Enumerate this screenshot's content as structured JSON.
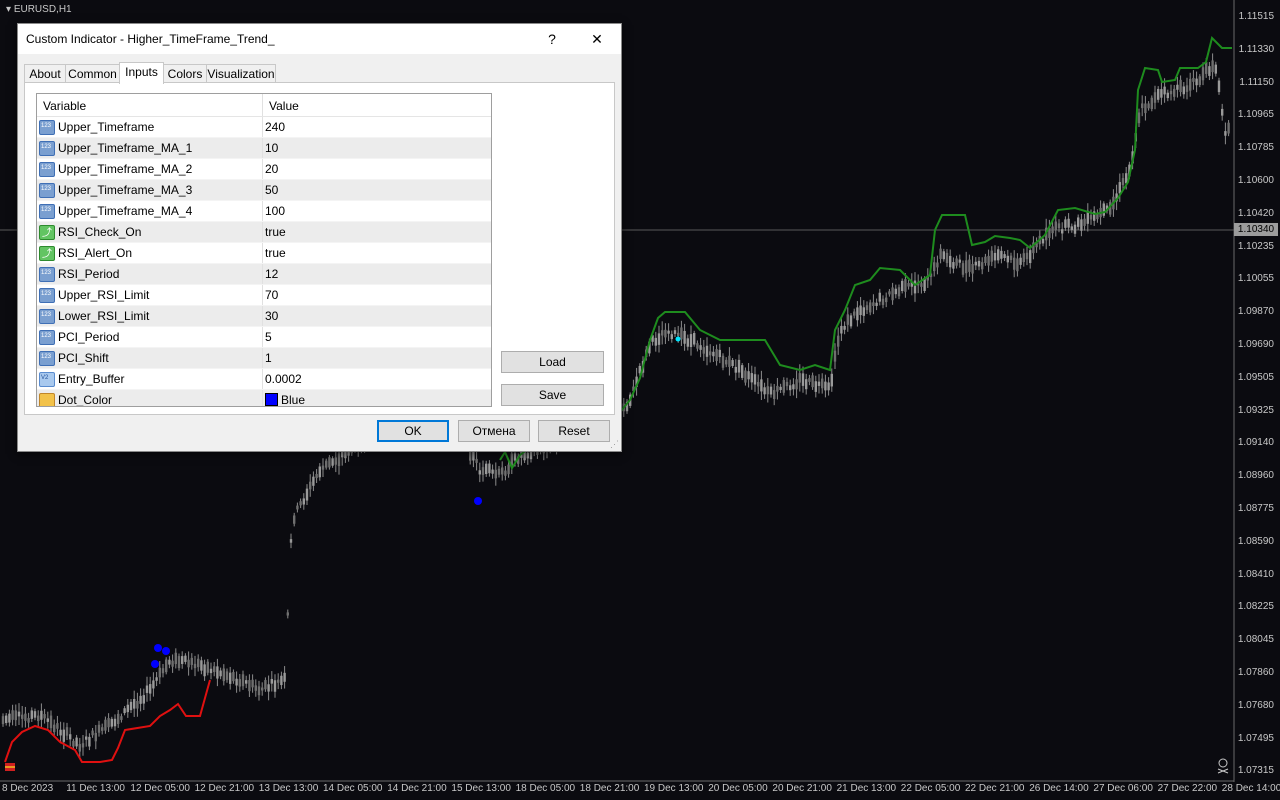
{
  "chart": {
    "symbol": "EURUSD,H1",
    "current_price": "1.10340",
    "price_labels": [
      "1.11515",
      "1.11330",
      "1.11150",
      "1.10965",
      "1.10785",
      "1.10600",
      "1.10420",
      "1.10235",
      "1.10055",
      "1.09870",
      "1.09690",
      "1.09505",
      "1.09325",
      "1.09140",
      "1.08960",
      "1.08775",
      "1.08590",
      "1.08410",
      "1.08225",
      "1.08045",
      "1.07860",
      "1.07680",
      "1.07495",
      "1.07315"
    ],
    "time_labels": [
      "8 Dec 2023",
      "11 Dec 13:00",
      "12 Dec 05:00",
      "12 Dec 21:00",
      "13 Dec 13:00",
      "14 Dec 05:00",
      "14 Dec 21:00",
      "15 Dec 13:00",
      "18 Dec 05:00",
      "18 Dec 21:00",
      "19 Dec 13:00",
      "20 Dec 05:00",
      "20 Dec 21:00",
      "21 Dec 13:00",
      "22 Dec 05:00",
      "22 Dec 21:00",
      "26 Dec 14:00",
      "27 Dec 06:00",
      "27 Dec 22:00",
      "28 Dec 14:00"
    ],
    "colors": {
      "background": "#0b0b10",
      "candles": "#8c8c8c",
      "trend_up": "#1e8c1e",
      "trend_down": "#e01010",
      "dots": "#0000ff",
      "dot_alt": "#00e5ff"
    }
  },
  "dialog": {
    "title": "Custom Indicator - Higher_TimeFrame_Trend_",
    "help": "?",
    "close": "✕",
    "tabs": [
      {
        "label": "About"
      },
      {
        "label": "Common"
      },
      {
        "label": "Inputs"
      },
      {
        "label": "Colors"
      },
      {
        "label": "Visualization"
      }
    ],
    "grid": {
      "header_variable": "Variable",
      "header_value": "Value",
      "rows": [
        {
          "variable": "Upper_Timeframe",
          "value": "240",
          "icon": "int-icon"
        },
        {
          "variable": "Upper_Timeframe_MA_1",
          "value": "10",
          "icon": "int-icon"
        },
        {
          "variable": "Upper_Timeframe_MA_2",
          "value": "20",
          "icon": "int-icon"
        },
        {
          "variable": "Upper_Timeframe_MA_3",
          "value": "50",
          "icon": "int-icon"
        },
        {
          "variable": "Upper_Timeframe_MA_4",
          "value": "100",
          "icon": "int-icon"
        },
        {
          "variable": "RSI_Check_On",
          "value": "true",
          "icon": "bool-icon"
        },
        {
          "variable": "RSI_Alert_On",
          "value": "true",
          "icon": "bool-icon"
        },
        {
          "variable": "RSI_Period",
          "value": "12",
          "icon": "int-icon"
        },
        {
          "variable": "Upper_RSI_Limit",
          "value": "70",
          "icon": "int-icon"
        },
        {
          "variable": "Lower_RSI_Limit",
          "value": "30",
          "icon": "int-icon"
        },
        {
          "variable": "PCI_Period",
          "value": "5",
          "icon": "int-icon"
        },
        {
          "variable": "PCI_Shift",
          "value": "1",
          "icon": "int-icon"
        },
        {
          "variable": "Entry_Buffer",
          "value": "0.0002",
          "icon": "double-icon"
        },
        {
          "variable": "Dot_Color",
          "value": "Blue",
          "icon": "color-icon",
          "swatch": "#0000ff"
        }
      ]
    },
    "buttons": {
      "load": "Load",
      "save": "Save",
      "ok": "OK",
      "cancel": "Отмена",
      "reset": "Reset"
    }
  }
}
